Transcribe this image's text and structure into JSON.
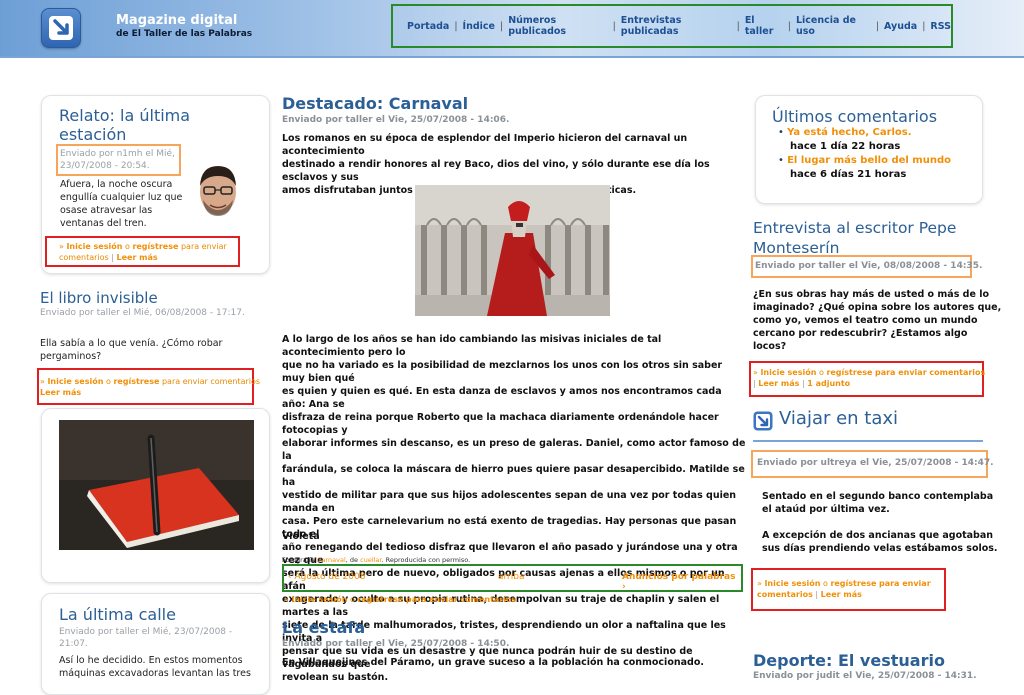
{
  "header": {
    "site_title": "Magazine digital",
    "site_subtitle": "de El Taller de las Palabras",
    "nav": [
      "Portada",
      "Índice",
      "Números publicados",
      "Entrevistas publicadas",
      "El taller",
      "Licencia de uso",
      "Ayuda",
      "RSS"
    ]
  },
  "left": {
    "relato": {
      "title_line1": "Relato: la última",
      "title_line2": "estación",
      "meta_line1": "Enviado por n1mh el Mié,",
      "meta_line2": "23/07/2008 - 20:54.",
      "body": [
        "Afuera, la noche oscura",
        "engullía cualquier luz que",
        "osase atravesar las",
        "ventanas del tren."
      ],
      "links_line1_a": "Inicie sesión",
      "links_line1_b": "o",
      "links_line1_c": "regístrese",
      "links_line1_d": "para enviar",
      "links_line2_a": "comentarios",
      "links_line2_b": "Leer más"
    },
    "libro": {
      "title": "El libro invisible",
      "meta": "Enviado por taller el Mié, 06/08/2008 - 17:17.",
      "body": [
        "Ella sabía a lo que venía. ¿Cómo robar",
        "pergaminos?"
      ],
      "links_a": "Inicie sesión",
      "links_b": "o",
      "links_c": "regístrese",
      "links_d": "para enviar comentarios",
      "links_e": "Leer más"
    },
    "calle": {
      "title": "La última calle",
      "meta_line1": "Enviado por taller el Mié, 23/07/2008 -",
      "meta_line2": "21:07.",
      "body": [
        "Así lo he decidido. En estos momentos",
        "máquinas excavadoras levantan las tres"
      ]
    }
  },
  "center": {
    "destacado": {
      "title": "Destacado: Carnaval",
      "meta": "Enviado por taller el Vie, 25/07/2008 - 14:06.",
      "intro": [
        "Los romanos en su época de esplendor del Imperio hicieron del carnaval un acontecimiento",
        "destinado a rendir honores al rey Baco, dios del vino, y sólo durante ese día los esclavos y sus",
        "amos disfrutaban juntos y como iguales de las fiestas orgiásticas."
      ],
      "body": [
        "A lo largo de los años se han ido cambiando las misivas iniciales de tal acontecimiento pero lo",
        "que no ha variado es la posibilidad de mezclarnos los unos con los otros sin saber muy bien qué",
        "es quien y quien es qué. En esta danza de esclavos y amos nos encontramos cada año: Ana se",
        "disfraza de reina porque Roberto que la machaca diariamente ordenándole hacer fotocopias y",
        "elaborar informes sin descanso, es un preso de galeras. Daniel, como actor famoso de la",
        "farándula, se coloca la máscara de hierro pues quiere pasar desapercibido. Matilde se ha",
        "vestido de militar para que sus hijos adolescentes sepan de una vez por todas quien manda en",
        "casa. Pero este carnelevarium no está exento de tragedias. Hay personas que pasan todo el",
        "año renegando del tedioso disfraz que llevaron el año pasado y jurándose una y otra vez que",
        "será la última pero de nuevo, obligados por causas ajenas a ellos mismos o por un afán",
        "exagerado y oculto a su propia rutina, desempolvan su traje de chaplin y salen el martes a las",
        "siete de la tarde malhumorados, tristes, desprendiendo un olor a naftalina que les invita a",
        "pensar que su vida es un desastre y que nunca podrán huir de su destino de vagabundos que",
        "revolean su bastón."
      ],
      "signature": "Violeta",
      "credit_a": "Fotografía",
      "credit_b": "Carnaval",
      "credit_c": ", de",
      "credit_d": "cuellar",
      "credit_e": ". Reproducida con permiso.",
      "pager_prev": "‹ Agosto de 2008",
      "pager_up": "arriba",
      "pager_next": "Anuncios por palabras ›",
      "links_a": "Inicie sesión",
      "links_b": "o",
      "links_c": "regístrese",
      "links_d": "para enviar comentarios"
    },
    "estafa": {
      "title": "La estafa",
      "meta": "Enviado por taller el Vie, 25/07/2008 - 14:50.",
      "body": "En Villaquejines del Páramo, un grave suceso a la población ha conmocionado."
    }
  },
  "right": {
    "comentarios": {
      "title": "Últimos comentarios",
      "items": [
        {
          "link": "Ya está hecho, Carlos.",
          "time": "hace 1 día 22 horas"
        },
        {
          "link": "El lugar más bello del mundo",
          "time": "hace 6 días 21 horas"
        }
      ]
    },
    "entrevista": {
      "title_line1": "Entrevista al escritor Pepe",
      "title_line2": "Monteserín",
      "meta": "Enviado por taller el Vie, 08/08/2008 - 14:35.",
      "body": [
        "¿En sus obras hay más de usted o más de lo",
        "imaginado? ¿Qué opina sobre los autores que,",
        "como yo, vemos el teatro como un mundo",
        "cercano por redescubrir? ¿Estamos algo",
        "locos?"
      ],
      "links_a": "Inicie sesión",
      "links_b": "o",
      "links_c": "regístrese",
      "links_d": "para enviar comentarios",
      "links_e": "Leer más",
      "links_f": "1 adjunto"
    },
    "taxi": {
      "title": "Viajar en taxi",
      "meta": "Enviado por ultreya el Vie, 25/07/2008 - 14:47.",
      "body1": [
        "Sentado en el segundo banco contemplaba",
        "el ataúd por última vez."
      ],
      "body2": [
        "A excepción de dos ancianas que agotaban",
        "sus días prendiendo velas estábamos solos."
      ],
      "links_a": "Inicie sesión",
      "links_b": "o",
      "links_c": "regístrese",
      "links_d": "para enviar",
      "links_e": "comentarios",
      "links_f": "Leer más"
    },
    "deporte": {
      "title": "Deporte: El vestuario",
      "meta": "Enviado por judit el Vie, 25/07/2008 - 14:31."
    }
  },
  "colors": {
    "accent_blue": "#2b5f95",
    "link_orange": "#f0900a",
    "annot_red": "#e02020",
    "annot_orange": "#f6a55a",
    "annot_green": "#2a8a2a"
  }
}
